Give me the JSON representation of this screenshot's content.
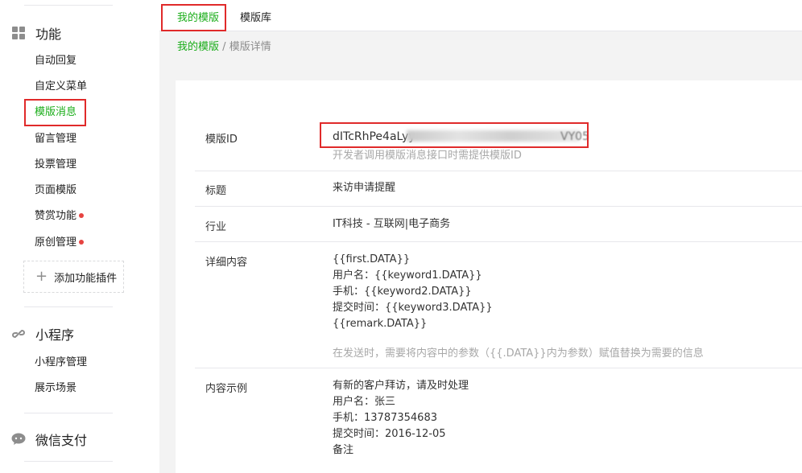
{
  "sidebar": {
    "features": {
      "icon": "grid-icon",
      "title": "功能",
      "items": [
        {
          "label": "自动回复"
        },
        {
          "label": "自定义菜单"
        },
        {
          "label": "模版消息",
          "active": true
        },
        {
          "label": "留言管理"
        },
        {
          "label": "投票管理"
        },
        {
          "label": "页面模版"
        },
        {
          "label": "赞赏功能",
          "badge": true
        },
        {
          "label": "原创管理",
          "badge": true
        }
      ],
      "add_plugin": "添加功能插件"
    },
    "miniprogram": {
      "icon": "link-icon",
      "title": "小程序",
      "items": [
        {
          "label": "小程序管理"
        },
        {
          "label": "展示场景"
        }
      ]
    },
    "wechat_pay": {
      "icon": "chat-bubble-icon",
      "title": "微信支付"
    }
  },
  "tabs": [
    {
      "label": "我的模版",
      "active": true
    },
    {
      "label": "模版库"
    }
  ],
  "breadcrumb": {
    "link": "我的模版",
    "separator": "/",
    "current": "模版详情"
  },
  "detail": {
    "template_id": {
      "label": "模版ID",
      "value": "dITcRhPe4aLyy",
      "value_tail": "VY05",
      "hint": "开发者调用模版消息接口时需提供模版ID"
    },
    "title": {
      "label": "标题",
      "value": "来访申请提醒"
    },
    "industry": {
      "label": "行业",
      "value": "IT科技 - 互联网|电子商务"
    },
    "content": {
      "label": "详细内容",
      "lines": [
        "{{first.DATA}}",
        "用户名：{{keyword1.DATA}}",
        "手机：{{keyword2.DATA}}",
        "提交时间：{{keyword3.DATA}}",
        "{{remark.DATA}}"
      ],
      "hint": "在发送时，需要将内容中的参数（{{.DATA}}内为参数）赋值替换为需要的信息"
    },
    "example": {
      "label": "内容示例",
      "lines": [
        "有新的客户拜访，请及时处理",
        "用户名：张三",
        "手机：13787354683",
        "提交时间：2016-12-05",
        "备注"
      ]
    }
  },
  "colors": {
    "accent": "#1aad19",
    "highlight": "#e02a2a",
    "badge": "#e64340"
  }
}
